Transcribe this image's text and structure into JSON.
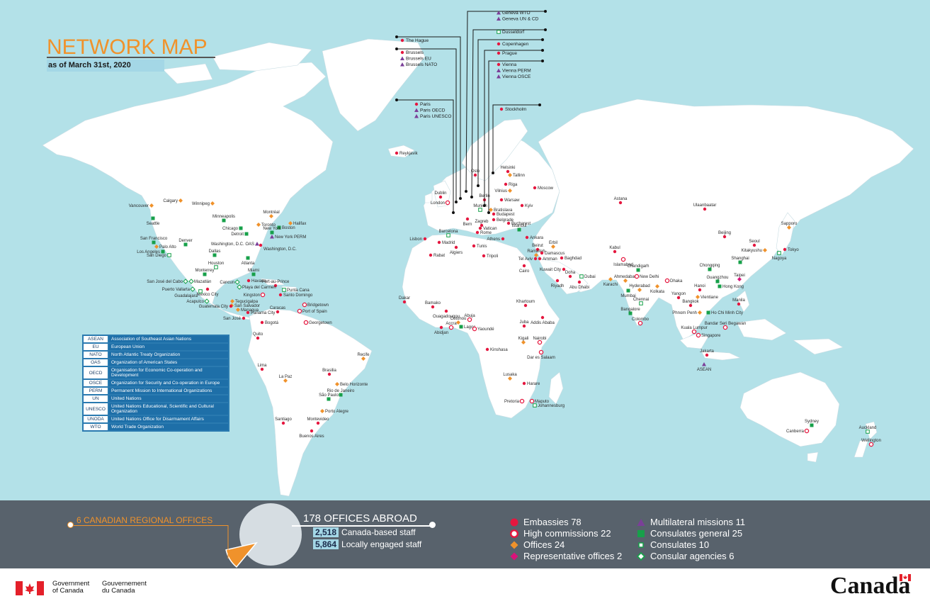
{
  "header": {
    "title": "NETWORK MAP",
    "subtitle": "as of March 31st, 2020"
  },
  "glossary": [
    {
      "abbr": "ASEAN",
      "full": "Association of Southeast Asian Nations"
    },
    {
      "abbr": "EU",
      "full": "European Union"
    },
    {
      "abbr": "NATO",
      "full": "North Atlantic Treaty Organization"
    },
    {
      "abbr": "OAS",
      "full": "Organization of American States"
    },
    {
      "abbr": "OECD",
      "full": "Organisation for Economic Co-operation and Development"
    },
    {
      "abbr": "OSCE",
      "full": "Organization for Security and Co-operation in Europe"
    },
    {
      "abbr": "PERM",
      "full": "Permanent Mission to International Organizations"
    },
    {
      "abbr": "UN",
      "full": "United Nations"
    },
    {
      "abbr": "UNESCO",
      "full": "United Nations Educational, Scientific and Cultural Organization"
    },
    {
      "abbr": "UNODA",
      "full": "United Nations Office for Disarmament Affairs"
    },
    {
      "abbr": "WTO",
      "full": "World Trade Organization"
    }
  ],
  "summary": {
    "regional_offices": "6 CANADIAN REGIONAL OFFICES",
    "offices_abroad": "178 OFFICES ABROAD",
    "canada_based_count": "2,518",
    "canada_based_label": "Canada-based staff",
    "local_count": "5,864",
    "local_label": "Locally engaged staff",
    "pie_share_regional": 0.0326
  },
  "legend": [
    {
      "label": "Embassies 78",
      "shape": "dot",
      "color": "#e5173f"
    },
    {
      "label": "High commissions 22",
      "shape": "ring",
      "color": "#e5173f"
    },
    {
      "label": "Offices 24",
      "shape": "diamond",
      "color": "#f0922b"
    },
    {
      "label": "Representative offices 2",
      "shape": "diamond",
      "color": "#d9127a"
    },
    {
      "label": "Multilateral missions 11",
      "shape": "triangle",
      "color": "#7b3f98"
    },
    {
      "label": "Consulates general 25",
      "shape": "square",
      "color": "#17a04a"
    },
    {
      "label": "Consulates 10",
      "shape": "square-open",
      "color": "#17a04a"
    },
    {
      "label": "Consular agencies 6",
      "shape": "diamond-open",
      "color": "#17a04a"
    }
  ],
  "europe_callouts": [
    {
      "items": [
        {
          "t": "Geneva WTO",
          "s": "triangle"
        },
        {
          "t": "Geneva UN & CD",
          "s": "triangle"
        }
      ]
    },
    {
      "items": [
        {
          "t": "Dusseldorf",
          "s": "square-open"
        }
      ]
    },
    {
      "items": [
        {
          "t": "The Hague",
          "s": "dot"
        }
      ]
    },
    {
      "items": [
        {
          "t": "Copenhagen",
          "s": "dot"
        }
      ]
    },
    {
      "items": [
        {
          "t": "Brussels",
          "s": "dot"
        },
        {
          "t": "Brussels EU",
          "s": "triangle"
        },
        {
          "t": "Brussels NATO",
          "s": "triangle"
        }
      ]
    },
    {
      "items": [
        {
          "t": "Prague",
          "s": "dot"
        }
      ]
    },
    {
      "items": [
        {
          "t": "Vienna",
          "s": "dot"
        },
        {
          "t": "Vienna PERM",
          "s": "triangle"
        },
        {
          "t": "Vienna OSCE",
          "s": "triangle"
        }
      ]
    },
    {
      "items": [
        {
          "t": "Paris",
          "s": "dot"
        },
        {
          "t": "Paris OECD",
          "s": "triangle"
        },
        {
          "t": "Paris UNESCO",
          "s": "triangle"
        }
      ]
    },
    {
      "items": [
        {
          "t": "Stockholm",
          "s": "dot"
        }
      ]
    }
  ],
  "cities": [
    {
      "n": "Reykjavik",
      "t": "dot"
    },
    {
      "n": "Vancouver",
      "t": "office"
    },
    {
      "n": "Calgary",
      "t": "office"
    },
    {
      "n": "Winnipeg",
      "t": "office"
    },
    {
      "n": "Montréal",
      "t": "office"
    },
    {
      "n": "Toronto",
      "t": "office"
    },
    {
      "n": "Halifax",
      "t": "office"
    },
    {
      "n": "Seattle",
      "t": "cg"
    },
    {
      "n": "Minneapolis",
      "t": "cg"
    },
    {
      "n": "Chicago",
      "t": "cg"
    },
    {
      "n": "Detroit",
      "t": "cg"
    },
    {
      "n": "Boston",
      "t": "cg"
    },
    {
      "n": "New York",
      "t": "cg"
    },
    {
      "n": "New York PERM",
      "t": "tri"
    },
    {
      "n": "San Francisco",
      "t": "cg"
    },
    {
      "n": "Palo Alto",
      "t": "office"
    },
    {
      "n": "Denver",
      "t": "cg"
    },
    {
      "n": "Washington, D.C. OAS",
      "t": "tri"
    },
    {
      "n": "Washington, D.C.",
      "t": "dot"
    },
    {
      "n": "Los Angeles",
      "t": "cg"
    },
    {
      "n": "San Diego",
      "t": "cons"
    },
    {
      "n": "Dallas",
      "t": "cg"
    },
    {
      "n": "Houston",
      "t": "cons"
    },
    {
      "n": "Atlanta",
      "t": "cg"
    },
    {
      "n": "Miami",
      "t": "cg"
    },
    {
      "n": "Monterrey",
      "t": "cg"
    },
    {
      "n": "Havana",
      "t": "dot"
    },
    {
      "n": "Cancun",
      "t": "agency"
    },
    {
      "n": "Port-au-Prince",
      "t": "dot"
    },
    {
      "n": "San José del Cabo",
      "t": "agency"
    },
    {
      "n": "Mazatlán",
      "t": "agency"
    },
    {
      "n": "Playa del Carmen",
      "t": "agency"
    },
    {
      "n": "Punta Cana",
      "t": "cons"
    },
    {
      "n": "Puerto Vallarta",
      "t": "agency"
    },
    {
      "n": "Mexico City",
      "t": "dot"
    },
    {
      "n": "Kingston",
      "t": "ring"
    },
    {
      "n": "Santo Domingo",
      "t": "dot"
    },
    {
      "n": "Guadalajara",
      "t": "cons"
    },
    {
      "n": "Acapulco",
      "t": "agency"
    },
    {
      "n": "Tegucigalpa",
      "t": "office"
    },
    {
      "n": "San Salvador",
      "t": "office"
    },
    {
      "n": "Guatemala City",
      "t": "dot"
    },
    {
      "n": "Managua",
      "t": "office"
    },
    {
      "n": "Bridgetown",
      "t": "ring"
    },
    {
      "n": "Panama City",
      "t": "dot"
    },
    {
      "n": "Caracas",
      "t": "dot"
    },
    {
      "n": "Port of Spain",
      "t": "ring"
    },
    {
      "n": "San José",
      "t": "dot"
    },
    {
      "n": "Bogotá",
      "t": "dot"
    },
    {
      "n": "Georgetown",
      "t": "ring"
    },
    {
      "n": "Quito",
      "t": "dot"
    },
    {
      "n": "Lima",
      "t": "dot"
    },
    {
      "n": "La Paz",
      "t": "office"
    },
    {
      "n": "Recife",
      "t": "office"
    },
    {
      "n": "Brasilia",
      "t": "dot"
    },
    {
      "n": "Belo Horizonte",
      "t": "office"
    },
    {
      "n": "Rio de Janeiro",
      "t": "cg"
    },
    {
      "n": "São Paulo",
      "t": "cg"
    },
    {
      "n": "Porto Alegre",
      "t": "office"
    },
    {
      "n": "Santiago",
      "t": "dot"
    },
    {
      "n": "Montevideo",
      "t": "dot"
    },
    {
      "n": "Buenos Aires",
      "t": "dot"
    },
    {
      "n": "Dublin",
      "t": "dot"
    },
    {
      "n": "London",
      "t": "ring"
    },
    {
      "n": "Oslo",
      "t": "dot"
    },
    {
      "n": "Helsinki",
      "t": "dot"
    },
    {
      "n": "Tallinn",
      "t": "office"
    },
    {
      "n": "Riga",
      "t": "dot"
    },
    {
      "n": "Moscow",
      "t": "dot"
    },
    {
      "n": "Berlin",
      "t": "dot"
    },
    {
      "n": "Vilnius",
      "t": "office"
    },
    {
      "n": "Warsaw",
      "t": "dot"
    },
    {
      "n": "Kyiv",
      "t": "dot"
    },
    {
      "n": "Munich",
      "t": "cons"
    },
    {
      "n": "Bratislava",
      "t": "office"
    },
    {
      "n": "Budapest",
      "t": "dot"
    },
    {
      "n": "Bern",
      "t": "dot"
    },
    {
      "n": "Zagreb",
      "t": "dot"
    },
    {
      "n": "Belgrade",
      "t": "dot"
    },
    {
      "n": "Bucharest",
      "t": "dot"
    },
    {
      "n": "Vatican",
      "t": "dot"
    },
    {
      "n": "Rome",
      "t": "dot"
    },
    {
      "n": "Barcelona",
      "t": "cons"
    },
    {
      "n": "Madrid",
      "t": "dot"
    },
    {
      "n": "Istanbul",
      "t": "cg"
    },
    {
      "n": "Ankara",
      "t": "dot"
    },
    {
      "n": "Lisbon",
      "t": "dot"
    },
    {
      "n": "Algiers",
      "t": "dot"
    },
    {
      "n": "Tunis",
      "t": "dot"
    },
    {
      "n": "Athens",
      "t": "dot"
    },
    {
      "n": "Erbil",
      "t": "office"
    },
    {
      "n": "Rabat",
      "t": "dot"
    },
    {
      "n": "Tripoli",
      "t": "dot"
    },
    {
      "n": "Beirut",
      "t": "dot"
    },
    {
      "n": "Ramallah",
      "t": "office"
    },
    {
      "n": "Damascus",
      "t": "dot"
    },
    {
      "n": "Tel Aviv",
      "t": "dot"
    },
    {
      "n": "Amman",
      "t": "dot"
    },
    {
      "n": "Baghdad",
      "t": "dot"
    },
    {
      "n": "Cairo",
      "t": "dot"
    },
    {
      "n": "Kuwait City",
      "t": "dot"
    },
    {
      "n": "Doha",
      "t": "dot"
    },
    {
      "n": "Dubai",
      "t": "cons"
    },
    {
      "n": "Riyadh",
      "t": "dot"
    },
    {
      "n": "Abu Dhabi",
      "t": "dot"
    },
    {
      "n": "Astana",
      "t": "dot"
    },
    {
      "n": "Ulaanbaatar",
      "t": "dot"
    },
    {
      "n": "Kabul",
      "t": "dot"
    },
    {
      "n": "Islamabad",
      "t": "ring"
    },
    {
      "n": "Chandigarh",
      "t": "cg"
    },
    {
      "n": "Ahmedabad",
      "t": "office"
    },
    {
      "n": "New Delhi",
      "t": "ring"
    },
    {
      "n": "Karachi",
      "t": "office"
    },
    {
      "n": "Hyderabad",
      "t": "office"
    },
    {
      "n": "Kolkata",
      "t": "office"
    },
    {
      "n": "Mumbai",
      "t": "cg"
    },
    {
      "n": "Chennai",
      "t": "cons"
    },
    {
      "n": "Bangalore",
      "t": "cg"
    },
    {
      "n": "Colombo",
      "t": "ring"
    },
    {
      "n": "Dhaka",
      "t": "ring"
    },
    {
      "n": "Beijing",
      "t": "dot"
    },
    {
      "n": "Seoul",
      "t": "dot"
    },
    {
      "n": "Sapporo",
      "t": "office"
    },
    {
      "n": "Tokyo",
      "t": "dot"
    },
    {
      "n": "Kitakyushu",
      "t": "office"
    },
    {
      "n": "Nagoya",
      "t": "cons"
    },
    {
      "n": "Shanghai",
      "t": "cg"
    },
    {
      "n": "Chongqing",
      "t": "cg"
    },
    {
      "n": "Guangzhou",
      "t": "cg"
    },
    {
      "n": "Taipei",
      "t": "rep"
    },
    {
      "n": "Hong Kong",
      "t": "cg"
    },
    {
      "n": "Hanoi",
      "t": "dot"
    },
    {
      "n": "Yangon",
      "t": "dot"
    },
    {
      "n": "Vientiane",
      "t": "office"
    },
    {
      "n": "Bangkok",
      "t": "dot"
    },
    {
      "n": "Manila",
      "t": "dot"
    },
    {
      "n": "Phnom Penh",
      "t": "office"
    },
    {
      "n": "Ho Chi Minh City",
      "t": "cg"
    },
    {
      "n": "Bandar Seri Begawan",
      "t": "ring"
    },
    {
      "n": "Kuala Lumpur",
      "t": "ring"
    },
    {
      "n": "Singapore",
      "t": "ring"
    },
    {
      "n": "Jakarta",
      "t": "dot"
    },
    {
      "n": "ASEAN",
      "t": "tri"
    },
    {
      "n": "Dakar",
      "t": "dot"
    },
    {
      "n": "Bamako",
      "t": "dot"
    },
    {
      "n": "Ouagadougou",
      "t": "dot"
    },
    {
      "n": "Abuja",
      "t": "ring"
    },
    {
      "n": "Cotonou",
      "t": "office"
    },
    {
      "n": "Accra",
      "t": "ring"
    },
    {
      "n": "Lagos",
      "t": "cg"
    },
    {
      "n": "Abidjan",
      "t": "dot"
    },
    {
      "n": "Yaoundé",
      "t": "ring"
    },
    {
      "n": "Khartoum",
      "t": "dot"
    },
    {
      "n": "Addis Ababa",
      "t": "dot"
    },
    {
      "n": "Juba",
      "t": "dot"
    },
    {
      "n": "Nairobi",
      "t": "ring"
    },
    {
      "n": "Kigali",
      "t": "office"
    },
    {
      "n": "Dar es Salaam",
      "t": "ring"
    },
    {
      "n": "Kinshasa",
      "t": "dot"
    },
    {
      "n": "Lusaka",
      "t": "office"
    },
    {
      "n": "Harare",
      "t": "dot"
    },
    {
      "n": "Pretoria",
      "t": "ring"
    },
    {
      "n": "Maputo",
      "t": "ring"
    },
    {
      "n": "Johannesburg",
      "t": "cons"
    },
    {
      "n": "Sydney",
      "t": "cg"
    },
    {
      "n": "Canberra",
      "t": "ring"
    },
    {
      "n": "Auckland",
      "t": "cons"
    },
    {
      "n": "Wellington",
      "t": "ring"
    }
  ],
  "footer": {
    "gov_en_1": "Government",
    "gov_en_2": "of Canada",
    "gov_fr_1": "Gouvernement",
    "gov_fr_2": "du Canada",
    "wordmark": "Canada"
  }
}
